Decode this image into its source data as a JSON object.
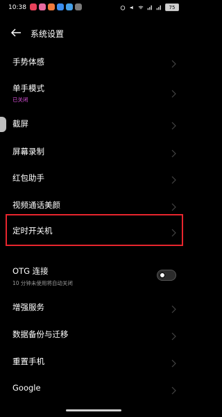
{
  "status_bar": {
    "time": "10:38",
    "battery": "75"
  },
  "header": {
    "title": "系统设置"
  },
  "items": [
    {
      "label": "手势体感"
    },
    {
      "label": "单手模式",
      "sub": "已关闭",
      "sub_color": "#d64fd6"
    },
    {
      "label": "截屏"
    },
    {
      "label": "屏幕录制"
    },
    {
      "label": "红包助手"
    },
    {
      "label": "视频通话美颜"
    },
    {
      "label": "定时开关机"
    },
    {
      "label": "OTG 连接",
      "sub": "10 分钟未使用将自动关闭",
      "toggle": "off"
    },
    {
      "label": "增强服务"
    },
    {
      "label": "数据备份与迁移"
    },
    {
      "label": "重置手机"
    },
    {
      "label": "Google"
    }
  ],
  "colors": {
    "background": "#000000",
    "highlight": "#e8252d",
    "accent": "#d64fd6"
  }
}
